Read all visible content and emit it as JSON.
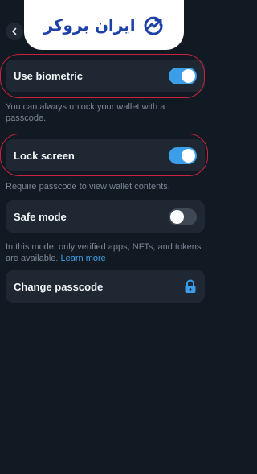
{
  "header": {
    "back_icon": "chevron-left-icon"
  },
  "watermark": {
    "text": "ایران بروکر",
    "icon": "trend-up-arrow-icon",
    "color": "#1c3fa8"
  },
  "settings": {
    "biometric": {
      "label": "Use biometric",
      "enabled": true,
      "caption": "You can always unlock your wallet with a passcode."
    },
    "lock_screen": {
      "label": "Lock screen",
      "enabled": true,
      "caption": "Require passcode to view wallet contents."
    },
    "safe_mode": {
      "label": "Safe mode",
      "enabled": false,
      "caption": "In this mode, only verified apps, NFTs, and tokens are available.",
      "link_label": "Learn more"
    },
    "change_passcode": {
      "label": "Change passcode",
      "icon": "lock-icon"
    }
  },
  "colors": {
    "background": "#111923",
    "card": "#1e2732",
    "accent": "#3c9ee8",
    "highlight": "#c8243e"
  }
}
